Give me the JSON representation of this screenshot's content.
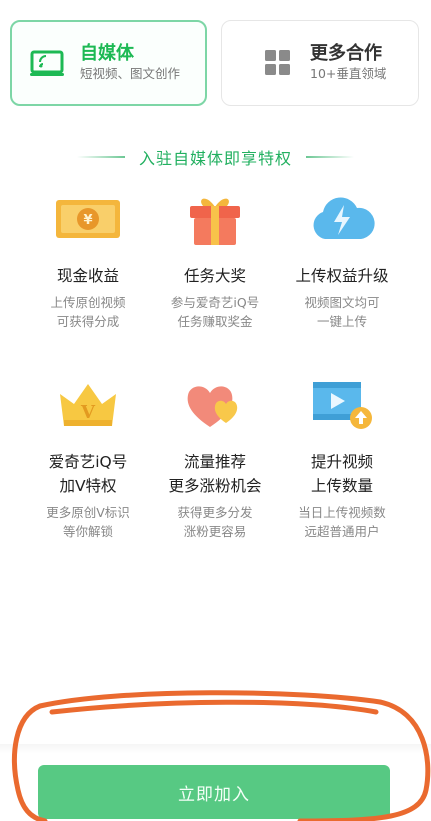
{
  "cards": [
    {
      "title": "自媒体",
      "subtitle": "短视频、图文创作",
      "icon": "tv-icon",
      "selected": true
    },
    {
      "title": "更多合作",
      "subtitle": "10+垂直领域",
      "icon": "grid-icon",
      "selected": false
    }
  ],
  "section_title": "入驻自媒体即享特权",
  "features": [
    {
      "name": "现金收益",
      "desc1": "上传原创视频",
      "desc2": "可获得分成",
      "icon": "banknote-icon"
    },
    {
      "name": "任务大奖",
      "desc1": "参与爱奇艺iQ号",
      "desc2": "任务赚取奖金",
      "icon": "gift-icon"
    },
    {
      "name": "上传权益升级",
      "desc1": "视频图文均可",
      "desc2": "一键上传",
      "icon": "cloud-lightning-icon"
    },
    {
      "name1": "爱奇艺iQ号",
      "name2": "加V特权",
      "desc1": "更多原创V标识",
      "desc2": "等你解锁",
      "icon": "crown-icon"
    },
    {
      "name1": "流量推荐",
      "name2": "更多涨粉机会",
      "desc1": "获得更多分发",
      "desc2": "涨粉更容易",
      "icon": "hearts-icon"
    },
    {
      "name1": "提升视频",
      "name2": "上传数量",
      "desc1": "当日上传视频数",
      "desc2": "远超普通用户",
      "icon": "video-upload-icon"
    }
  ],
  "join_button": "立即加入",
  "colors": {
    "accent": "#1db954",
    "button": "#57c983",
    "annotation": "#ea6a2f"
  }
}
